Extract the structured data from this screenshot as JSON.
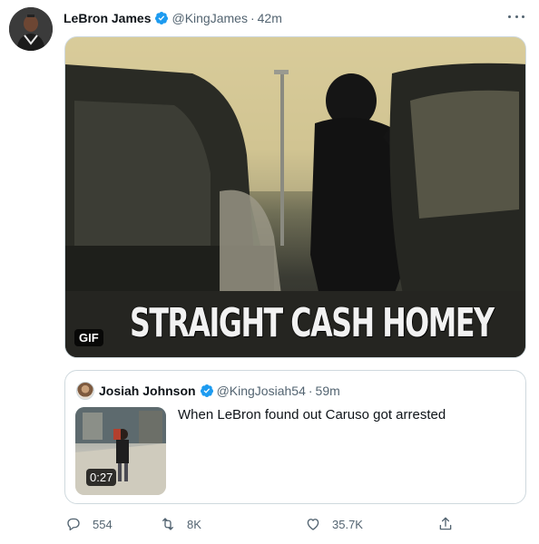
{
  "tweet": {
    "author_name": "LeBron James",
    "author_handle": "@KingJames",
    "separator": "·",
    "time": "42m",
    "media": {
      "caption": "STRAIGHT CASH HOMEY",
      "badge": "GIF"
    }
  },
  "quoted": {
    "author_name": "Josiah Johnson",
    "author_handle": "@KingJosiah54",
    "separator": "·",
    "time": "59m",
    "text": "When LeBron found out Caruso got arrested",
    "video_duration": "0:27"
  },
  "actions": {
    "replies": "554",
    "retweets": "8K",
    "likes": "35.7K"
  },
  "icons": {
    "verified": "verified-badge-icon",
    "more": "more-horizontal-icon",
    "reply": "reply-icon",
    "retweet": "retweet-icon",
    "like": "heart-icon",
    "share": "share-icon"
  },
  "colors": {
    "verified_blue": "#1d9bf0",
    "secondary_text": "#536471",
    "border": "#cfd9de"
  }
}
